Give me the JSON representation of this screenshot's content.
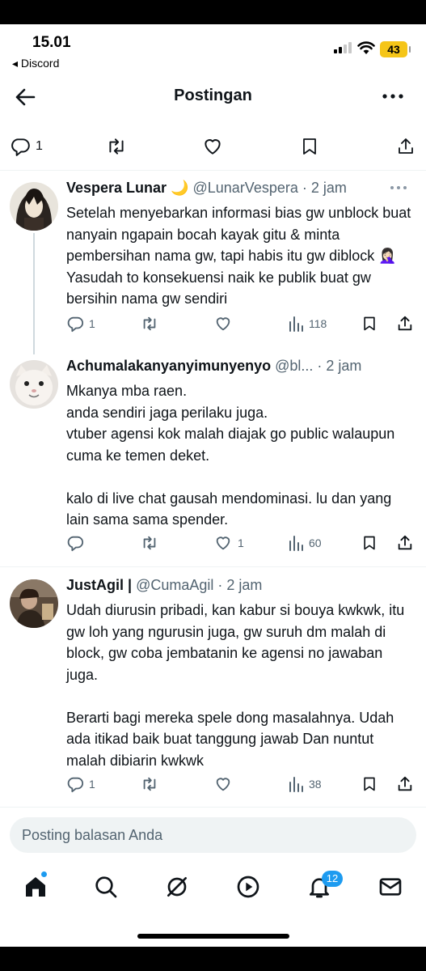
{
  "status_bar": {
    "time": "15.01",
    "back_app": "◂ Discord",
    "battery": "43"
  },
  "header": {
    "title": "Postingan"
  },
  "main_post_actions": {
    "replies": "1"
  },
  "tweets": [
    {
      "name": "Vespera Lunar 🌙",
      "meta": "@LunarVespera · 2 jam",
      "text": "Setelah menyebarkan informasi bias gw unblock buat nanyain ngapain bocah kayak gitu & minta pembersihan nama gw, tapi habis itu gw diblock 🤦🏻‍♀️ Yasudah to konsekuensi naik ke publik buat gw bersihin nama gw sendiri",
      "replies": "1",
      "retweets": "",
      "likes": "",
      "views": "118"
    },
    {
      "name": "Achumalakanyanyimunyenyo",
      "meta": "@bl... · 2 jam",
      "text": "Mkanya mba raen.\nanda sendiri jaga perilaku juga.\nvtuber agensi kok malah diajak go public walaupun cuma ke temen deket.\n\nkalo di live chat gausah mendominasi. lu dan yang lain sama sama spender.",
      "replies": "",
      "retweets": "",
      "likes": "1",
      "views": "60"
    },
    {
      "name": "JustAgil |",
      "meta": "@CumaAgil · 2 jam",
      "text": "Udah diurusin pribadi, kan kabur si bouya kwkwk, itu gw loh yang ngurusin juga, gw suruh dm malah di block, gw coba jembatanin ke agensi no jawaban juga.\n\nBerarti bagi mereka spele dong masalahnya. Udah ada itikad baik buat tanggung jawab Dan nuntut malah dibiarin kwkwk",
      "replies": "1",
      "retweets": "",
      "likes": "",
      "views": "38"
    }
  ],
  "reply_input": {
    "placeholder": "Posting balasan Anda"
  },
  "nav": {
    "notifications_badge": "12"
  },
  "colors": {
    "accent": "#1d9bf0",
    "secondary_text": "#536471",
    "primary_text": "#0f1419"
  },
  "icons": [
    "back-arrow-icon",
    "more-icon",
    "reply-icon",
    "retweet-icon",
    "like-icon",
    "views-icon",
    "bookmark-icon",
    "share-icon",
    "home-icon",
    "search-icon",
    "grok-icon",
    "video-icon",
    "bell-icon",
    "mail-icon"
  ]
}
